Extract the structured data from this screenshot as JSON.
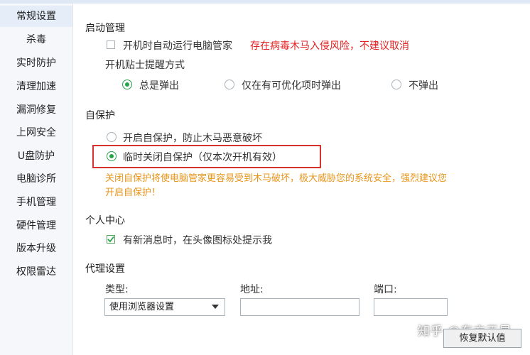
{
  "sidebar": {
    "items": [
      {
        "label": "常规设置",
        "active": true
      },
      {
        "label": "杀毒"
      },
      {
        "label": "实时防护"
      },
      {
        "label": "清理加速"
      },
      {
        "label": "漏洞修复"
      },
      {
        "label": "上网安全"
      },
      {
        "label": "U盘防护"
      },
      {
        "label": "电脑诊所"
      },
      {
        "label": "手机管理"
      },
      {
        "label": "硬件管理"
      },
      {
        "label": "版本升级"
      },
      {
        "label": "权限雷达"
      }
    ]
  },
  "startup": {
    "title": "启动管理",
    "autorun_label": "开机时自动运行电脑管家",
    "autorun_checked": false,
    "autorun_warning": "存在病毒木马入侵风险，不建议取消",
    "tips_title": "开机贴士提醒方式",
    "tips_options": [
      {
        "label": "总是弹出",
        "checked": true
      },
      {
        "label": "仅在有可优化项时弹出",
        "checked": false
      },
      {
        "label": "不弹出",
        "checked": false
      }
    ]
  },
  "self_protect": {
    "title": "自保护",
    "options": [
      {
        "label": "开启自保护，防止木马恶意破坏",
        "checked": false
      },
      {
        "label": "临时关闭自保护（仅本次开机有效）",
        "checked": true
      }
    ],
    "warning": "关闭自保护将使电脑管家更容易受到木马破坏，极大威胁您的系统安全，强烈建议您开启自保护！"
  },
  "personal": {
    "title": "个人中心",
    "notify_label": "有新消息时，在头像图标处提示我",
    "notify_checked": true
  },
  "proxy": {
    "title": "代理设置",
    "type_label": "类型:",
    "type_value": "使用浏览器设置",
    "address_label": "地址:",
    "address_value": "",
    "port_label": "端口:",
    "port_value": ""
  },
  "footer": {
    "restore_label": "恢复默认值",
    "watermark": "知乎 @东方天星"
  },
  "colors": {
    "warning_red": "#e32020",
    "warning_orange": "#e8951a",
    "check_green": "#25a34a",
    "highlight_border": "#d8322f"
  }
}
